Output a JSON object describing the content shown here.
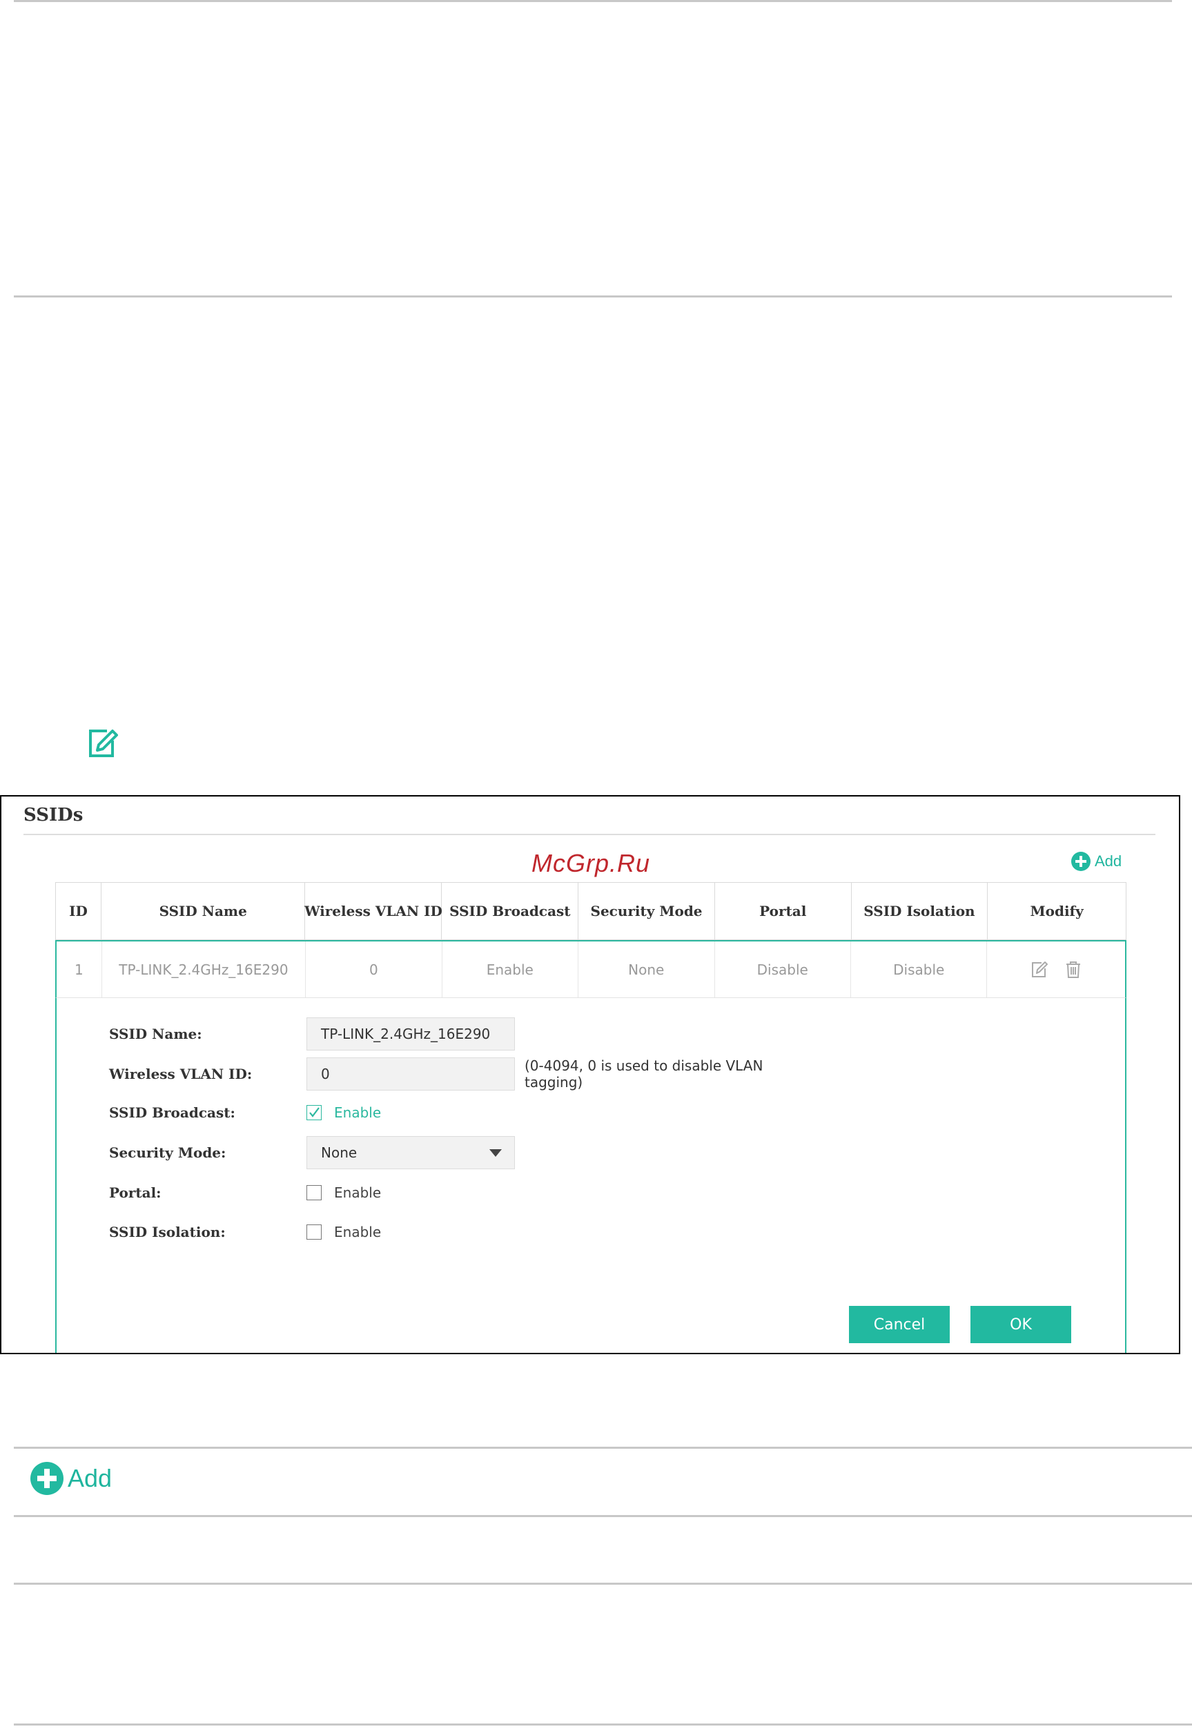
{
  "panel": {
    "title": "SSIDs",
    "watermark": "McGrp.Ru",
    "add_label": "Add",
    "table": {
      "headers": [
        "ID",
        "SSID Name",
        "Wireless VLAN ID",
        "SSID Broadcast",
        "Security Mode",
        "Portal",
        "SSID Isolation",
        "Modify"
      ],
      "row": [
        "1",
        "TP-LINK_2.4GHz_16E290",
        "0",
        "Enable",
        "None",
        "Disable",
        "Disable"
      ]
    },
    "form": {
      "ssid_name_label": "SSID Name:",
      "ssid_name_value": "TP-LINK_2.4GHz_16E290",
      "vlan_label": "Wireless VLAN ID:",
      "vlan_value": "0",
      "vlan_hint": "(0-4094, 0 is used to disable VLAN tagging)",
      "broadcast_label": "SSID Broadcast:",
      "broadcast_text": "Enable",
      "security_label": "Security Mode:",
      "security_value": "None",
      "portal_label": "Portal:",
      "portal_text": "Enable",
      "isolation_label": "SSID Isolation:",
      "isolation_text": "Enable"
    },
    "buttons": {
      "cancel": "Cancel",
      "ok": "OK"
    }
  },
  "bottom_add_label": "Add",
  "colors": {
    "accent": "#22b9a0",
    "watermark": "#c0272d"
  },
  "icons": [
    "note-edit-icon",
    "add-circle-icon",
    "edit-icon",
    "trash-icon",
    "caret-down-icon",
    "checkmark-icon"
  ]
}
